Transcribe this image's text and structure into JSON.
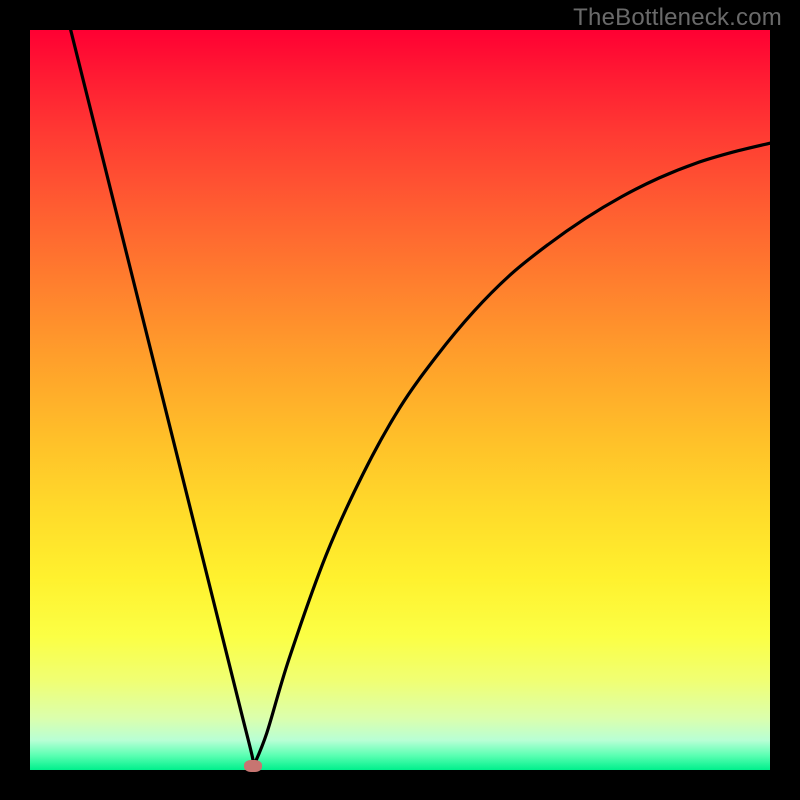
{
  "watermark": "TheBottleneck.com",
  "chart_data": {
    "type": "line",
    "title": "",
    "xlabel": "",
    "ylabel": "",
    "xlim": [
      0,
      1
    ],
    "ylim": [
      0,
      1
    ],
    "gradient_description": "background vertical gradient red→orange→yellow→green (top=1, bottom=0)",
    "series": [
      {
        "name": "left-branch",
        "x": [
          0.055,
          0.08,
          0.11,
          0.14,
          0.17,
          0.2,
          0.23,
          0.26,
          0.285,
          0.3,
          0.302
        ],
        "y": [
          1.0,
          0.9,
          0.78,
          0.66,
          0.54,
          0.42,
          0.3,
          0.18,
          0.08,
          0.02,
          0.005
        ]
      },
      {
        "name": "right-branch",
        "x": [
          0.302,
          0.32,
          0.35,
          0.4,
          0.45,
          0.5,
          0.55,
          0.6,
          0.65,
          0.7,
          0.75,
          0.8,
          0.85,
          0.9,
          0.95,
          1.0
        ],
        "y": [
          0.005,
          0.05,
          0.15,
          0.29,
          0.4,
          0.49,
          0.56,
          0.62,
          0.67,
          0.71,
          0.745,
          0.775,
          0.8,
          0.82,
          0.835,
          0.847
        ]
      }
    ],
    "marker": {
      "x": 0.302,
      "y": 0.005,
      "color": "#c77571",
      "shape": "pill"
    }
  },
  "colors": {
    "frame": "#000000",
    "curve": "#000000",
    "watermark": "#6a6a6a",
    "marker": "#c77571"
  }
}
